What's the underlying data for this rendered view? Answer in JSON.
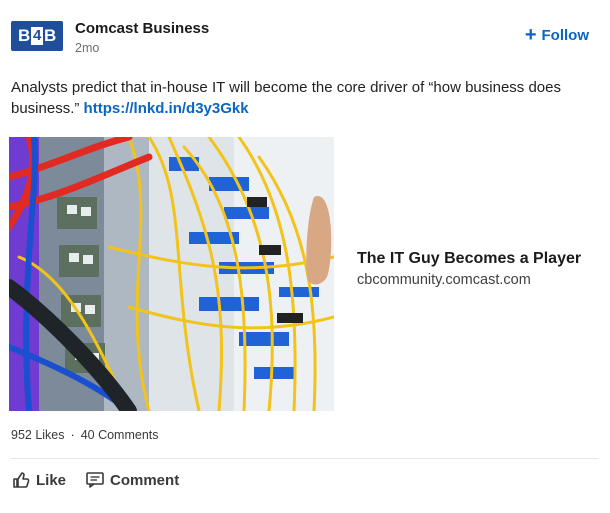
{
  "post": {
    "author": {
      "logo_text_left": "B",
      "logo_text_mid": "4",
      "logo_text_right": "B",
      "name": "Comcast Business",
      "age": "2mo"
    },
    "follow_label": "Follow",
    "body_text": "Analysts predict that in-house IT will become the core driver of “how business does business.”",
    "body_link": "https://lnkd.in/d3y3Gkk",
    "article": {
      "title": "The IT Guy Becomes a Player",
      "domain": "cbcommunity.comcast.com"
    },
    "social": {
      "likes": "952 Likes",
      "separator": "·",
      "comments": "40 Comments"
    },
    "actions": {
      "like_label": "Like",
      "comment_label": "Comment"
    }
  },
  "icons": {
    "follow": "plus-icon",
    "like": "thumbs-up-icon",
    "comment": "comment-icon"
  },
  "colors": {
    "brand": "#1f4f9a",
    "link": "#0a66c2"
  }
}
